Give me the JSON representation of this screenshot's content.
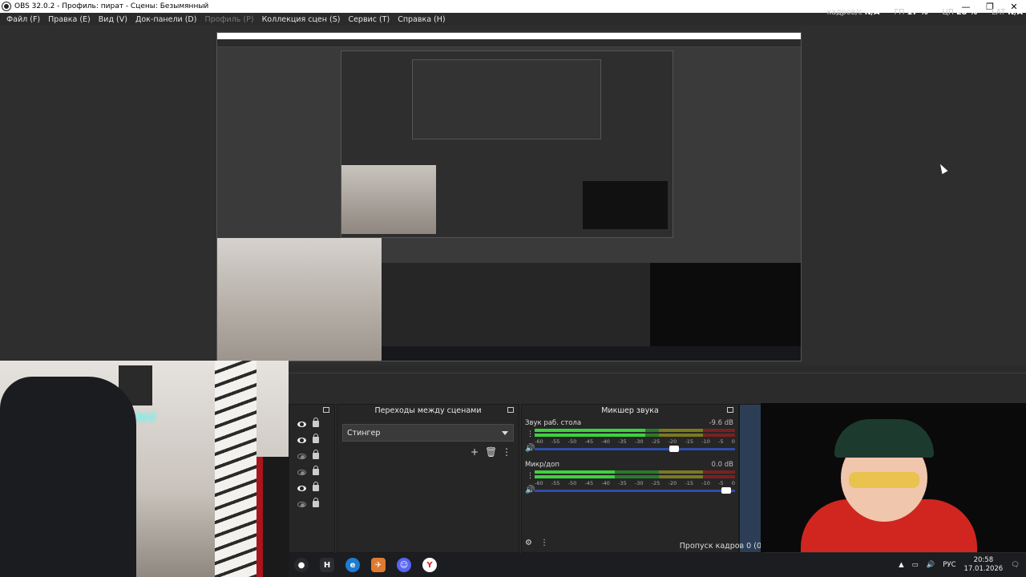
{
  "window": {
    "title": "OBS 32.0.2 - Профиль: пират - Сцены: Безымянный",
    "minimize": "—",
    "maximize": "❐",
    "close": "✕"
  },
  "menu": {
    "items": [
      {
        "label": "Файл (F)",
        "disabled": false
      },
      {
        "label": "Правка (E)",
        "disabled": false
      },
      {
        "label": "Вид (V)",
        "disabled": false
      },
      {
        "label": "Док-панели (D)",
        "disabled": false
      },
      {
        "label": "Профиль (P)",
        "disabled": true
      },
      {
        "label": "Коллекция сцен (S)",
        "disabled": false
      },
      {
        "label": "Сервис (T)",
        "disabled": false
      },
      {
        "label": "Справка (H)",
        "disabled": false
      }
    ]
  },
  "stats": {
    "fps_label": "кадров/с",
    "fps_value": "N/A",
    "gpu_label": "ГП",
    "gpu_value": "17 %",
    "cpu_label": "ЦП",
    "cpu_value": "28 %",
    "lat_label": "LAT",
    "lat_value": "N/A"
  },
  "preview": {
    "neon_text": "Metod"
  },
  "transitions": {
    "title": "Переходы между сценами",
    "selected": "Стингер"
  },
  "mixer": {
    "title": "Микшер звука",
    "ticks": [
      "-60",
      "-55",
      "-50",
      "-45",
      "-40",
      "-35",
      "-30",
      "-25",
      "-20",
      "-15",
      "-10",
      "-5",
      "0"
    ],
    "channels": [
      {
        "name": "Звук раб. стола",
        "db": "-9.6 dB",
        "level": 0.55,
        "volume": 0.72
      },
      {
        "name": "Микр/доп",
        "db": "0.0 dB",
        "level": 0.4,
        "volume": 0.98
      }
    ]
  },
  "status": {
    "dropped_frames": "Пропуск кадров 0 (0"
  },
  "taskbar": {
    "lang": "РУС",
    "time": "20:58",
    "date": "17.01.2026",
    "apps": [
      {
        "icon": "obs-icon",
        "color": "#2a2a2a",
        "glyph": "●"
      },
      {
        "icon": "h-app-icon",
        "color": "#2b2d31",
        "glyph": "H"
      },
      {
        "icon": "edge-icon",
        "color": "#1f7bd1",
        "glyph": "e"
      },
      {
        "icon": "telegram-icon",
        "color": "#e07a2f",
        "glyph": "✈"
      },
      {
        "icon": "discord-icon",
        "color": "#5865f2",
        "glyph": "☺"
      },
      {
        "icon": "yandex-icon",
        "color": "#ffffff",
        "glyph": "Y"
      }
    ]
  }
}
